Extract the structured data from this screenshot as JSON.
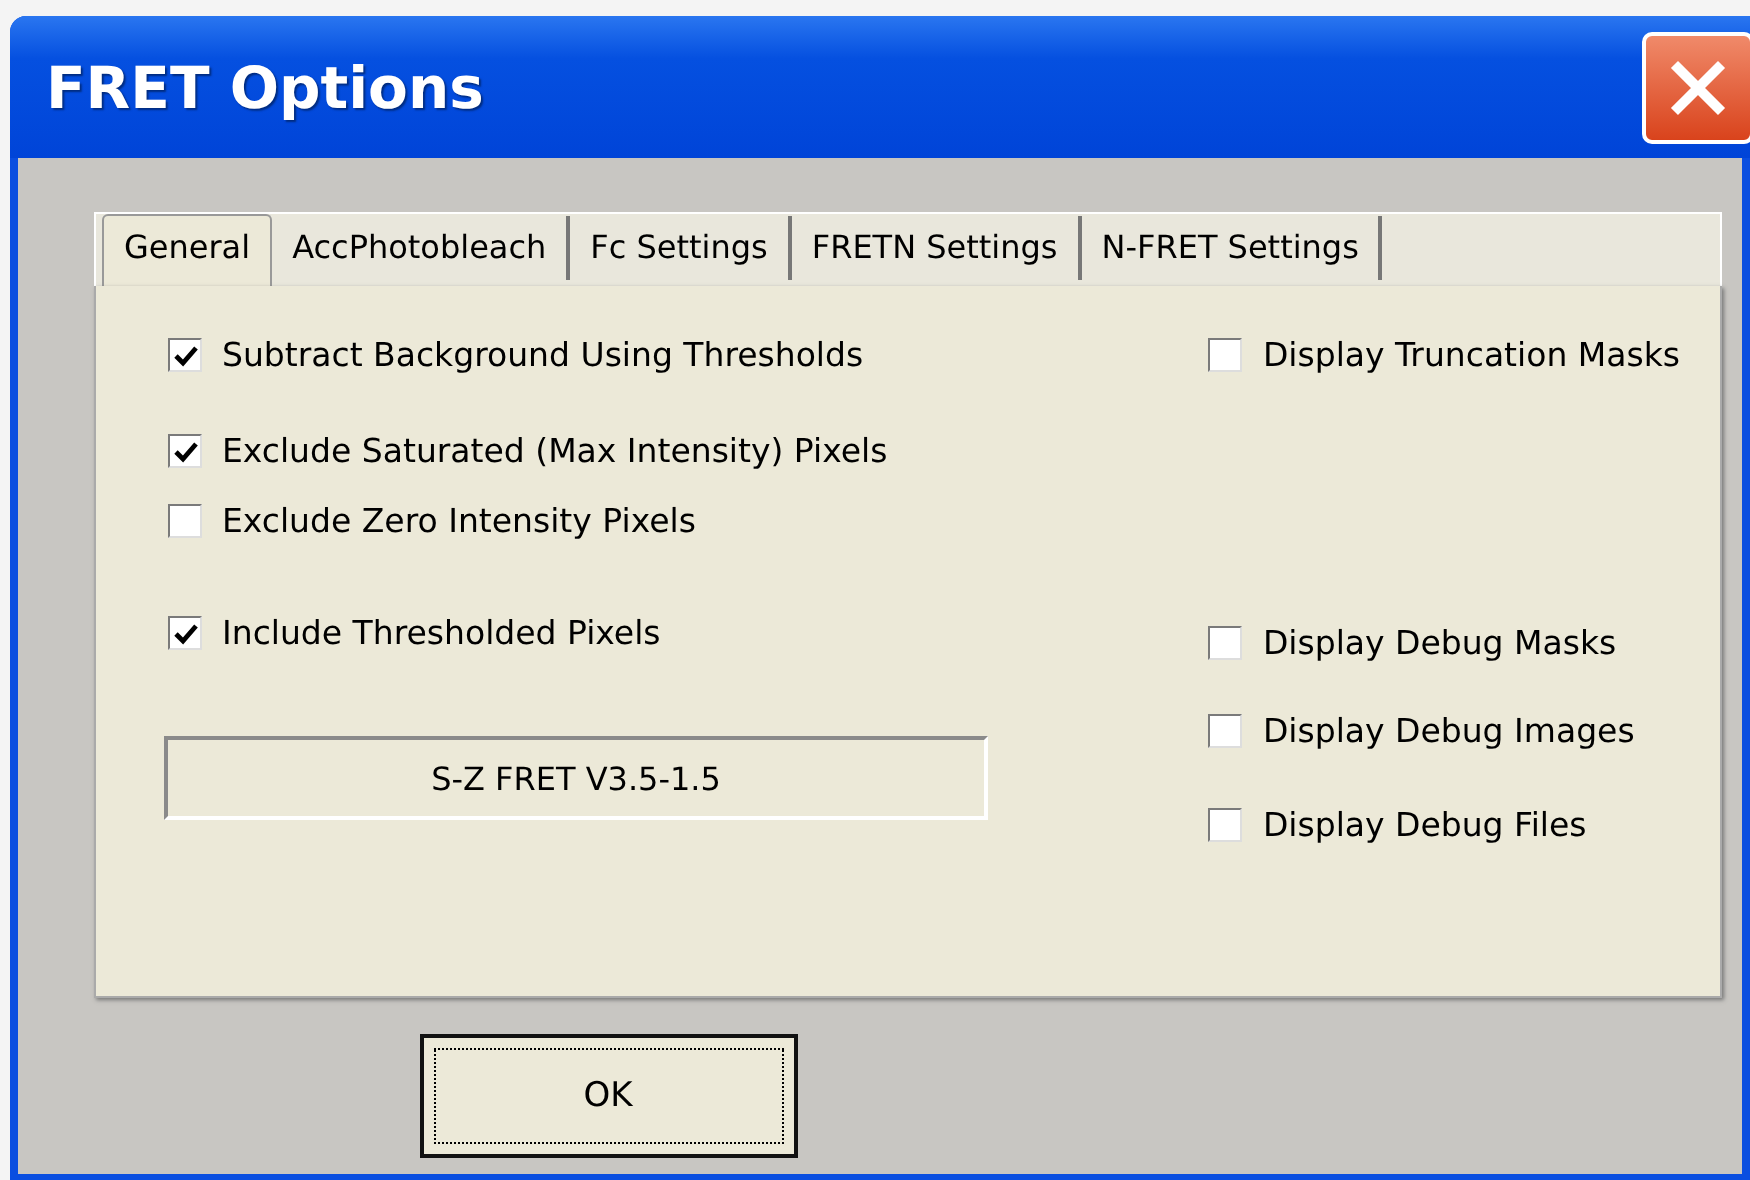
{
  "window": {
    "title": "FRET Options"
  },
  "tabs": [
    {
      "label": "General",
      "selected": true
    },
    {
      "label": "AccPhotobleach",
      "selected": false
    },
    {
      "label": "Fc Settings",
      "selected": false
    },
    {
      "label": "FRETN Settings",
      "selected": false
    },
    {
      "label": "N-FRET Settings",
      "selected": false
    }
  ],
  "left_options": [
    {
      "label": "Subtract Background Using Thresholds",
      "checked": true
    },
    {
      "label": "Exclude Saturated (Max Intensity) Pixels",
      "checked": true
    },
    {
      "label": "Exclude Zero Intensity Pixels",
      "checked": false
    },
    {
      "label": "Include Thresholded Pixels",
      "checked": true
    }
  ],
  "version_label": "S-Z FRET V3.5-1.5",
  "right_options": [
    {
      "label": "Display Truncation Masks",
      "checked": false
    },
    {
      "label": "Display Debug Masks",
      "checked": false
    },
    {
      "label": "Display Debug Images",
      "checked": false
    },
    {
      "label": "Display Debug Files",
      "checked": false
    }
  ],
  "buttons": [
    "OK"
  ]
}
